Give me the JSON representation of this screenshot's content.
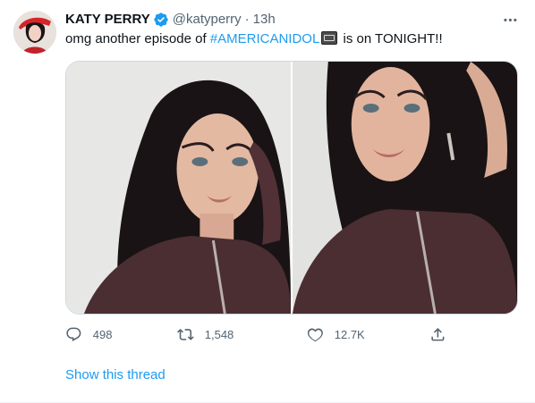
{
  "author": {
    "name": "KATY PERRY",
    "handle": "@katyperry",
    "separator": "·",
    "time": "13h"
  },
  "tweet": {
    "text_before": "omg another episode of ",
    "hashtag": "#AMERICANIDOL",
    "text_after": " is on TONIGHT!!"
  },
  "actions": {
    "replies": "498",
    "retweets": "1,548",
    "likes": "12.7K"
  },
  "show_thread": "Show this thread",
  "colors": {
    "accent": "#1d9bf0",
    "secondary_text": "#536471"
  },
  "icons": {
    "verified": "verified-badge-icon",
    "more": "more-icon",
    "reply": "reply-icon",
    "retweet": "retweet-icon",
    "like": "like-icon",
    "share": "share-icon"
  }
}
